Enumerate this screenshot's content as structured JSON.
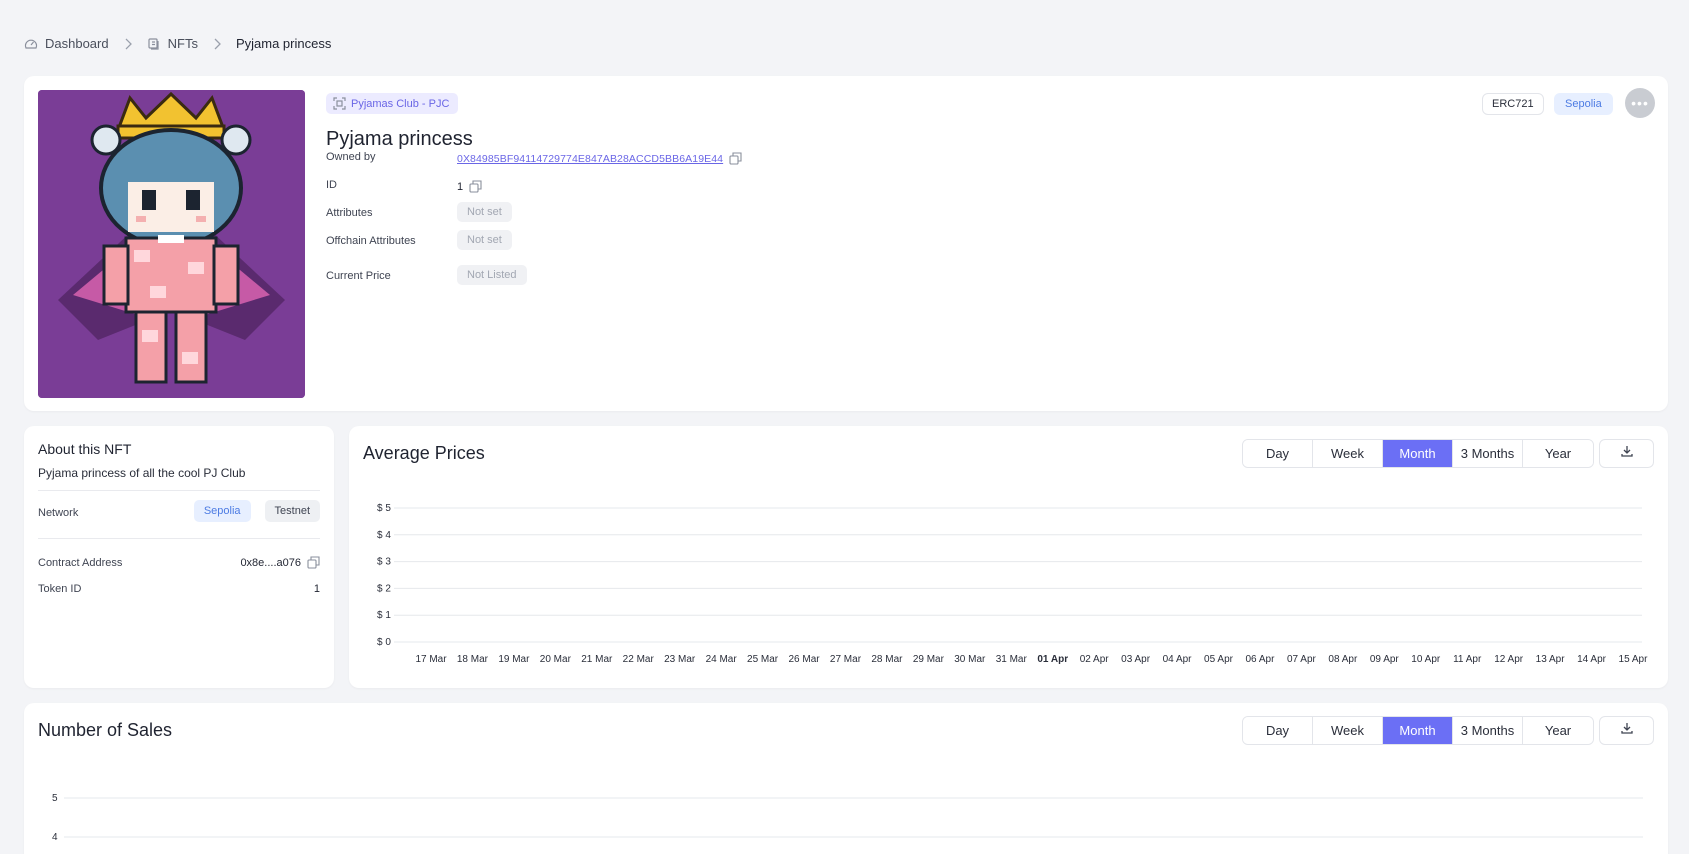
{
  "breadcrumb": {
    "items": [
      {
        "label": "Dashboard",
        "icon": "dashboard-icon"
      },
      {
        "label": "NFTs",
        "icon": "nfts-icon"
      },
      {
        "label": "Pyjama princess"
      }
    ]
  },
  "nft": {
    "collection": "Pyjamas Club - PJC",
    "title": "Pyjama princess",
    "standard": "ERC721",
    "network": "Sepolia",
    "fields": {
      "owned_by_label": "Owned by",
      "owned_by_value": "0X84985BF94114729774E847AB28ACCD5BB6A19E44",
      "id_label": "ID",
      "id_value": "1",
      "attributes_label": "Attributes",
      "attributes_value": "Not set",
      "offchain_label": "Offchain Attributes",
      "offchain_value": "Not set",
      "price_label": "Current Price",
      "price_value": "Not Listed"
    },
    "image_colors": {
      "background": "#7a3d96",
      "crown": "#f2c230",
      "hair": "#5b8fb0",
      "pyjama": "#f4a0a8"
    }
  },
  "about": {
    "title": "About this NFT",
    "description": "Pyjama princess of all the cool PJ Club",
    "network_label": "Network",
    "network_value": "Sepolia",
    "network_type": "Testnet",
    "contract_label": "Contract Address",
    "contract_value": "0x8e....a076",
    "token_label": "Token ID",
    "token_value": "1"
  },
  "ranges": [
    "Day",
    "Week",
    "Month",
    "3 Months",
    "Year"
  ],
  "active_range": "Month",
  "colors": {
    "accent": "#6b6ff5",
    "link": "#6a66e6",
    "network": "#4c7be3"
  },
  "avg_prices": {
    "title": "Average Prices"
  },
  "sales": {
    "title": "Number of Sales"
  },
  "chart_data": [
    {
      "type": "line",
      "title": "Average Prices",
      "x": [
        "17 Mar",
        "18 Mar",
        "19 Mar",
        "20 Mar",
        "21 Mar",
        "22 Mar",
        "23 Mar",
        "24 Mar",
        "25 Mar",
        "26 Mar",
        "27 Mar",
        "28 Mar",
        "29 Mar",
        "30 Mar",
        "31 Mar",
        "01 Apr",
        "02 Apr",
        "03 Apr",
        "04 Apr",
        "05 Apr",
        "06 Apr",
        "07 Apr",
        "08 Apr",
        "09 Apr",
        "10 Apr",
        "11 Apr",
        "12 Apr",
        "13 Apr",
        "14 Apr",
        "15 Apr"
      ],
      "bold_tick": "01 Apr",
      "y_ticks": [
        "$ 0",
        "$ 1",
        "$ 2",
        "$ 3",
        "$ 4",
        "$ 5"
      ],
      "ylim": [
        0,
        5
      ],
      "series": [],
      "grid": true
    },
    {
      "type": "line",
      "title": "Number of Sales",
      "y_ticks": [
        "4",
        "5"
      ],
      "ylim": [
        0,
        5
      ],
      "series": [],
      "grid": true
    }
  ]
}
